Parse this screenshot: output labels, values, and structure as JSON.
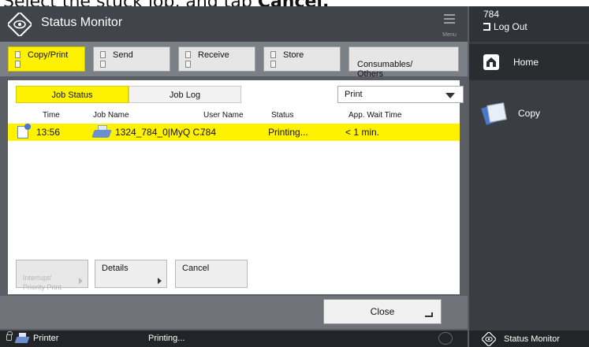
{
  "caption": {
    "prefix": "Select the stuck job, and tap ",
    "bold": "Cancel."
  },
  "titlebar": {
    "title": "Status Monitor",
    "menu_label": "Menu"
  },
  "user": {
    "id": "784",
    "logout_label": "Log Out"
  },
  "sidebar": {
    "home_label": "Home",
    "copy_label": "Copy",
    "status_monitor_label": "Status Monitor"
  },
  "categories": [
    {
      "label": "Copy/Print",
      "active": true
    },
    {
      "label": "Send",
      "active": false
    },
    {
      "label": "Receive",
      "active": false
    },
    {
      "label": "Store",
      "active": false
    },
    {
      "label": "Consumables/\nOthers",
      "active": false
    }
  ],
  "status_tabs": {
    "job_status": "Job Status",
    "job_log": "Job Log"
  },
  "filter": {
    "selected": "Print"
  },
  "table": {
    "headers": {
      "time": "Time",
      "job_name": "Job Name",
      "user_name": "User Name",
      "status": "Status",
      "wait": "App. Wait Time"
    },
    "rows": [
      {
        "time": "13:56",
        "job_name": "1324_784_0|MyQ C..",
        "user_name": "784",
        "status": "Printing...",
        "wait": "< 1 min."
      }
    ]
  },
  "actions": {
    "interrupt": "Interrupt/\nPriority Print",
    "details": "Details",
    "cancel": "Cancel"
  },
  "close_label": "Close",
  "statusbar": {
    "device": "Printer",
    "state": "Printing..."
  },
  "colors": {
    "accent": "#fff200",
    "frame": "#5a5d63",
    "dark": "#222427"
  }
}
